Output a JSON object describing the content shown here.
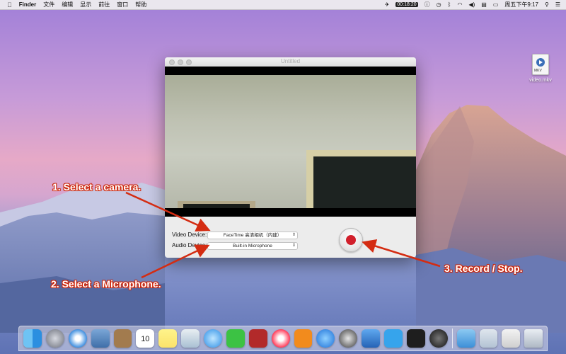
{
  "menubar": {
    "app_name": "Finder",
    "menus": [
      "文件",
      "编辑",
      "显示",
      "前往",
      "窗口",
      "帮助"
    ],
    "timer": "00:18:20",
    "clock": "周五下午9:17"
  },
  "desktop": {
    "file_name": "video.mkv",
    "file_ext": "MKV"
  },
  "window": {
    "title": "Untitled",
    "video_label": "Video Device:",
    "video_value": "FaceTime 高清相机（内建）",
    "audio_label": "Audio Device:",
    "audio_value": "Built-in Microphone"
  },
  "annotations": {
    "step1": "1. Select a camera.",
    "step2": "2. Select a Microphone.",
    "step3": "3. Record / Stop."
  },
  "colors": {
    "annotation_red": "#d42c12",
    "record_red": "#d11f2b"
  },
  "dock": {
    "icons": [
      "finder-icon",
      "launchpad-icon",
      "safari-icon",
      "photo-icon",
      "contacts-icon",
      "calendar-icon",
      "notes-icon",
      "preview-icon",
      "messages-icon",
      "facetime-icon",
      "photobooth-icon",
      "itunes-icon",
      "ibooks-icon",
      "appstore-icon",
      "quicktime-icon",
      "xcode-icon",
      "twitter-icon",
      "terminal-icon",
      "camera-icon",
      "applications-folder-icon",
      "downloads-icon",
      "documents-icon",
      "trash-icon"
    ],
    "calendar_day": "10",
    "calendar_month": "10月"
  }
}
